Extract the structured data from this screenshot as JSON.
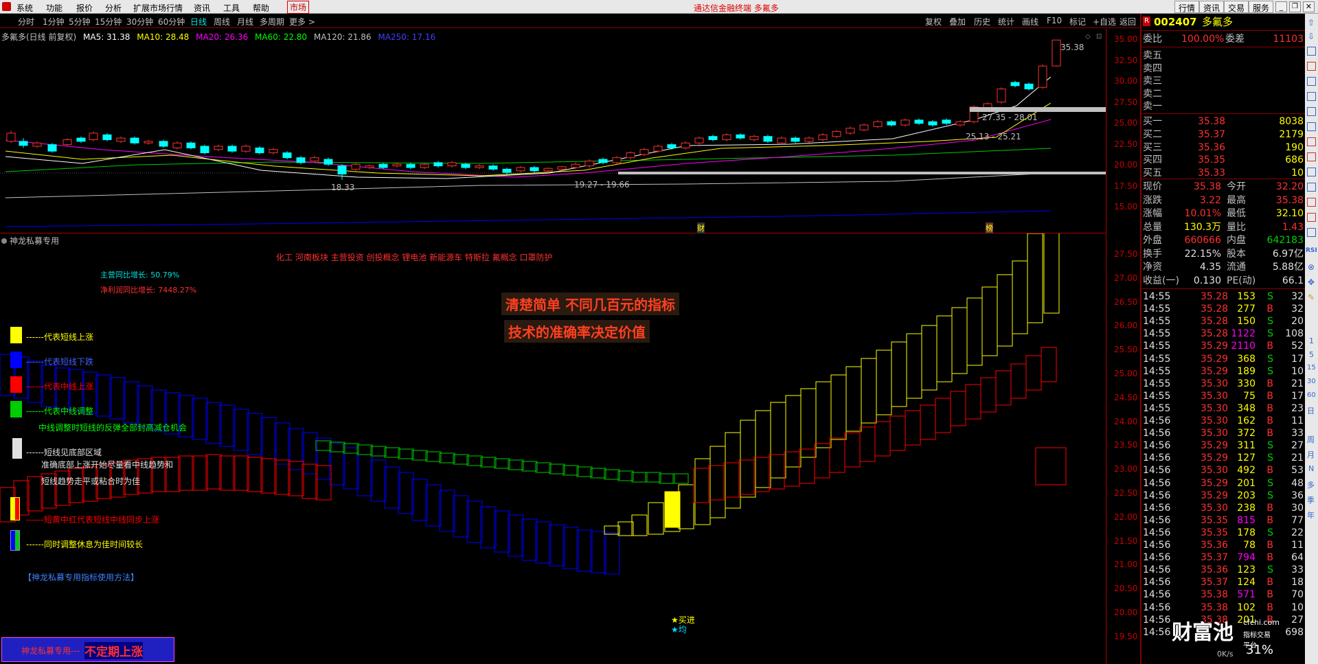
{
  "menubar": {
    "items": [
      "系统",
      "功能",
      "报价",
      "分析",
      "扩展市场行情",
      "资讯",
      "工具",
      "帮助",
      "市场"
    ],
    "title": "通达信金融终端  多氟多",
    "right": [
      "行情",
      "资讯",
      "交易",
      "服务"
    ]
  },
  "toolbar": {
    "periods": [
      "分时",
      "1分钟",
      "5分钟",
      "15分钟",
      "30分钟",
      "60分钟",
      "日线",
      "周线",
      "月线",
      "多周期",
      "更多 >"
    ],
    "active": "日线",
    "right": [
      "复权",
      "叠加",
      "历史",
      "统计",
      "画线",
      "F10",
      "标记",
      "+自选",
      "返回"
    ]
  },
  "main_chart": {
    "header": {
      "name": "多氟多(日线 前复权)",
      "ma5": "MA5: 31.38",
      "ma10": "MA10: 28.48",
      "ma20": "MA20: 26.36",
      "ma60": "MA60: 22.80",
      "ma120": "MA120: 21.86",
      "ma250": "MA250: 17.16"
    },
    "annotations": {
      "high": "35.38",
      "low": "18.33",
      "range1": "19.27 - 19.66",
      "range2": "27.35 - 28.01",
      "range3": "25.13 - 25.21",
      "marker_cai": "财",
      "marker_bang": "榜"
    },
    "y_ticks": [
      "35.00",
      "32.50",
      "30.00",
      "27.50",
      "25.00",
      "22.50",
      "20.00",
      "17.50",
      "15.00"
    ],
    "colors": {
      "ma5": "#ffffff",
      "ma10": "#ffff00",
      "ma20": "#ff00ff",
      "ma60": "#00ff00",
      "ma120": "#c0c0c0",
      "ma250": "#0000ff",
      "up": "#ff3030",
      "down": "#00ffff"
    }
  },
  "indicator": {
    "title": "神龙私募专用",
    "concepts": "化工 河南板块 主营投资 创投概念 锂电池 新能源车 特斯拉 氟概念 口罩防护",
    "revenue_growth": "主营同比增长: 50.79%",
    "profit_growth": "净利润同比增长: 7448.27%",
    "banner1": "清楚简单  不同几百元的指标",
    "banner2": "技术的准确率决定价值",
    "legend": [
      {
        "color": "#ffff00",
        "text": "------代表短线上涨",
        "tc": "#ffff00"
      },
      {
        "color": "#0000ff",
        "text": "------代表短线下跌",
        "tc": "#4040ff"
      },
      {
        "color": "#ff0000",
        "text": "------代表中线上涨",
        "tc": "#ff0000"
      },
      {
        "color": "#00cc00",
        "text": "------代表中线调整",
        "tc": "#00ff00"
      }
    ],
    "note1": "中线调整时短线的反弹全部封高减仓机会",
    "note2a": "------短线见底部区域",
    "note2b": "准确底部上涨开始尽量看中线趋势和",
    "note2c": "短线趋势走平或粘合时为佳",
    "note3": "------短黄中红代表短线中线同步上涨",
    "note4": "------同时调整休息为佳时间较长",
    "method": "【神龙私募专用指标使用方法】",
    "signal1": "★买进",
    "signal2": "★均",
    "footer_small": "神龙私募专用---",
    "footer_big": "不定期上涨",
    "y_ticks": [
      "27.50",
      "27.00",
      "26.50",
      "26.00",
      "25.50",
      "25.00",
      "24.50",
      "24.00",
      "23.50",
      "23.00",
      "22.50",
      "22.00",
      "21.50",
      "21.00",
      "20.50",
      "20.00",
      "19.50"
    ]
  },
  "quote": {
    "code": "002407",
    "name": "多氟多",
    "weibi_label": "委比",
    "weibi": "100.00%",
    "weicha_label": "委差",
    "weicha": "11103",
    "sells": [
      {
        "label": "卖五",
        "price": "",
        "vol": ""
      },
      {
        "label": "卖四",
        "price": "",
        "vol": ""
      },
      {
        "label": "卖三",
        "price": "",
        "vol": ""
      },
      {
        "label": "卖二",
        "price": "",
        "vol": ""
      },
      {
        "label": "卖一",
        "price": "",
        "vol": ""
      }
    ],
    "buys": [
      {
        "label": "买一",
        "price": "35.38",
        "vol": "8038"
      },
      {
        "label": "买二",
        "price": "35.37",
        "vol": "2179"
      },
      {
        "label": "买三",
        "price": "35.36",
        "vol": "190"
      },
      {
        "label": "买四",
        "price": "35.35",
        "vol": "686"
      },
      {
        "label": "买五",
        "price": "35.33",
        "vol": "10"
      }
    ],
    "stats": [
      {
        "l1": "现价",
        "v1": "35.38",
        "c1": "red",
        "l2": "今开",
        "v2": "32.20",
        "c2": "red"
      },
      {
        "l1": "涨跌",
        "v1": "3.22",
        "c1": "red",
        "l2": "最高",
        "v2": "35.38",
        "c2": "red"
      },
      {
        "l1": "涨幅",
        "v1": "10.01%",
        "c1": "red",
        "l2": "最低",
        "v2": "32.10",
        "c2": "yel"
      },
      {
        "l1": "总量",
        "v1": "130.3万",
        "c1": "yel",
        "l2": "量比",
        "v2": "1.43",
        "c2": "red"
      },
      {
        "l1": "外盘",
        "v1": "660666",
        "c1": "red",
        "l2": "内盘",
        "v2": "642183",
        "c2": "grn"
      },
      {
        "l1": "换手",
        "v1": "22.15%",
        "c1": "wht",
        "l2": "股本",
        "v2": "6.97亿",
        "c2": "wht"
      },
      {
        "l1": "净资",
        "v1": "4.35",
        "c1": "wht",
        "l2": "流通",
        "v2": "5.88亿",
        "c2": "wht"
      },
      {
        "l1": "收益(一)",
        "v1": "0.130",
        "c1": "wht",
        "l2": "PE(动)",
        "v2": "66.1",
        "c2": "wht"
      }
    ],
    "ticks": [
      {
        "t": "14:55",
        "p": "35.28",
        "v": "153",
        "s": "S",
        "n": "32"
      },
      {
        "t": "14:55",
        "p": "35.28",
        "v": "277",
        "s": "B",
        "n": "32"
      },
      {
        "t": "14:55",
        "p": "35.28",
        "v": "150",
        "s": "S",
        "n": "20"
      },
      {
        "t": "14:55",
        "p": "35.28",
        "v": "1122",
        "s": "S",
        "n": "108"
      },
      {
        "t": "14:55",
        "p": "35.29",
        "v": "2110",
        "s": "B",
        "n": "52"
      },
      {
        "t": "14:55",
        "p": "35.29",
        "v": "368",
        "s": "S",
        "n": "17"
      },
      {
        "t": "14:55",
        "p": "35.29",
        "v": "189",
        "s": "S",
        "n": "10"
      },
      {
        "t": "14:55",
        "p": "35.30",
        "v": "330",
        "s": "B",
        "n": "21"
      },
      {
        "t": "14:55",
        "p": "35.30",
        "v": "75",
        "s": "B",
        "n": "17"
      },
      {
        "t": "14:55",
        "p": "35.30",
        "v": "348",
        "s": "B",
        "n": "23"
      },
      {
        "t": "14:56",
        "p": "35.30",
        "v": "162",
        "s": "B",
        "n": "11"
      },
      {
        "t": "14:56",
        "p": "35.30",
        "v": "372",
        "s": "B",
        "n": "33"
      },
      {
        "t": "14:56",
        "p": "35.29",
        "v": "311",
        "s": "S",
        "n": "27"
      },
      {
        "t": "14:56",
        "p": "35.29",
        "v": "127",
        "s": "S",
        "n": "21"
      },
      {
        "t": "14:56",
        "p": "35.30",
        "v": "492",
        "s": "B",
        "n": "53"
      },
      {
        "t": "14:56",
        "p": "35.29",
        "v": "201",
        "s": "S",
        "n": "48"
      },
      {
        "t": "14:56",
        "p": "35.29",
        "v": "203",
        "s": "S",
        "n": "36"
      },
      {
        "t": "14:56",
        "p": "35.30",
        "v": "238",
        "s": "B",
        "n": "30"
      },
      {
        "t": "14:56",
        "p": "35.35",
        "v": "815",
        "s": "B",
        "n": "77"
      },
      {
        "t": "14:56",
        "p": "35.35",
        "v": "178",
        "s": "S",
        "n": "22"
      },
      {
        "t": "14:56",
        "p": "35.36",
        "v": "78",
        "s": "B",
        "n": "11"
      },
      {
        "t": "14:56",
        "p": "35.37",
        "v": "794",
        "s": "B",
        "n": "64"
      },
      {
        "t": "14:56",
        "p": "35.36",
        "v": "123",
        "s": "S",
        "n": "33"
      },
      {
        "t": "14:56",
        "p": "35.37",
        "v": "124",
        "s": "B",
        "n": "18"
      },
      {
        "t": "14:56",
        "p": "35.38",
        "v": "571",
        "s": "B",
        "n": "70"
      },
      {
        "t": "14:56",
        "p": "35.38",
        "v": "102",
        "s": "B",
        "n": "10"
      },
      {
        "t": "14:56",
        "p": "35.38",
        "v": "201",
        "s": "B",
        "n": "27"
      },
      {
        "t": "14:56",
        "p": "",
        "v": "",
        "s": "",
        "n": "698"
      }
    ],
    "watermark": "财富池",
    "watermark_url": "cfchi.com",
    "watermark_sub": "指标交易平台",
    "net_speed": "0K/s",
    "net_pct": "31%"
  },
  "side_icons": [
    "周",
    "月",
    "N",
    "多",
    "季",
    "年"
  ]
}
